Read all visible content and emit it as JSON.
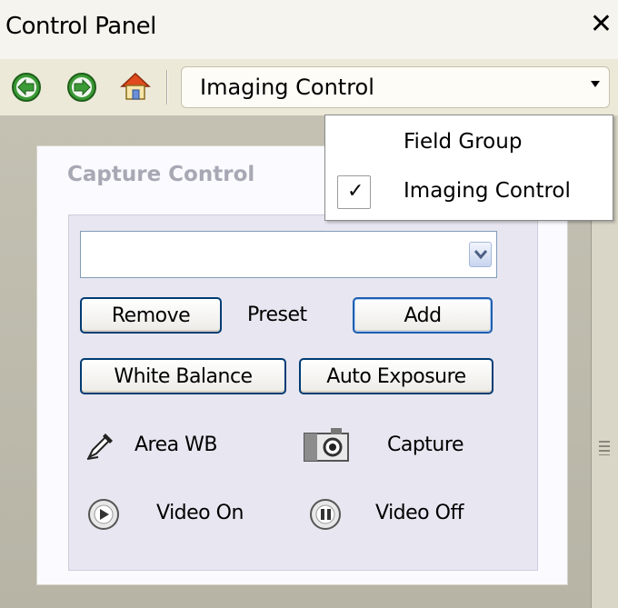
{
  "window": {
    "title": "Control Panel"
  },
  "toolbar": {
    "back": "back-icon",
    "forward": "forward-icon",
    "home": "home-icon",
    "view_selected": "Imaging Control"
  },
  "dropdown": {
    "items": [
      {
        "label": "Field Group",
        "checked": false
      },
      {
        "label": "Imaging Control",
        "checked": true
      }
    ],
    "check_mark": "✓"
  },
  "panel": {
    "title": "Capture Control",
    "preset_combo_value": "",
    "remove_label": "Remove",
    "preset_label": "Preset",
    "add_label": "Add",
    "white_balance_label": "White Balance",
    "auto_exposure_label": "Auto Exposure",
    "area_wb_label": "Area WB",
    "capture_label": "Capture",
    "video_on_label": "Video On",
    "video_off_label": "Video Off"
  },
  "colors": {
    "button_border": "#003c74",
    "default_border": "#1e5fb0",
    "nav_green": "#3a9a35"
  }
}
